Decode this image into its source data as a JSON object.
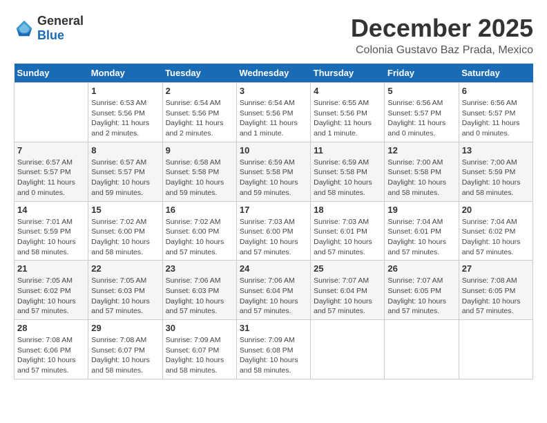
{
  "header": {
    "logo_general": "General",
    "logo_blue": "Blue",
    "title": "December 2025",
    "subtitle": "Colonia Gustavo Baz Prada, Mexico"
  },
  "days_of_week": [
    "Sunday",
    "Monday",
    "Tuesday",
    "Wednesday",
    "Thursday",
    "Friday",
    "Saturday"
  ],
  "weeks": [
    [
      {
        "day": "",
        "info": ""
      },
      {
        "day": "1",
        "info": "Sunrise: 6:53 AM\nSunset: 5:56 PM\nDaylight: 11 hours\nand 2 minutes."
      },
      {
        "day": "2",
        "info": "Sunrise: 6:54 AM\nSunset: 5:56 PM\nDaylight: 11 hours\nand 2 minutes."
      },
      {
        "day": "3",
        "info": "Sunrise: 6:54 AM\nSunset: 5:56 PM\nDaylight: 11 hours\nand 1 minute."
      },
      {
        "day": "4",
        "info": "Sunrise: 6:55 AM\nSunset: 5:56 PM\nDaylight: 11 hours\nand 1 minute."
      },
      {
        "day": "5",
        "info": "Sunrise: 6:56 AM\nSunset: 5:57 PM\nDaylight: 11 hours\nand 0 minutes."
      },
      {
        "day": "6",
        "info": "Sunrise: 6:56 AM\nSunset: 5:57 PM\nDaylight: 11 hours\nand 0 minutes."
      }
    ],
    [
      {
        "day": "7",
        "info": "Sunrise: 6:57 AM\nSunset: 5:57 PM\nDaylight: 11 hours\nand 0 minutes."
      },
      {
        "day": "8",
        "info": "Sunrise: 6:57 AM\nSunset: 5:57 PM\nDaylight: 10 hours\nand 59 minutes."
      },
      {
        "day": "9",
        "info": "Sunrise: 6:58 AM\nSunset: 5:58 PM\nDaylight: 10 hours\nand 59 minutes."
      },
      {
        "day": "10",
        "info": "Sunrise: 6:59 AM\nSunset: 5:58 PM\nDaylight: 10 hours\nand 59 minutes."
      },
      {
        "day": "11",
        "info": "Sunrise: 6:59 AM\nSunset: 5:58 PM\nDaylight: 10 hours\nand 58 minutes."
      },
      {
        "day": "12",
        "info": "Sunrise: 7:00 AM\nSunset: 5:58 PM\nDaylight: 10 hours\nand 58 minutes."
      },
      {
        "day": "13",
        "info": "Sunrise: 7:00 AM\nSunset: 5:59 PM\nDaylight: 10 hours\nand 58 minutes."
      }
    ],
    [
      {
        "day": "14",
        "info": "Sunrise: 7:01 AM\nSunset: 5:59 PM\nDaylight: 10 hours\nand 58 minutes."
      },
      {
        "day": "15",
        "info": "Sunrise: 7:02 AM\nSunset: 6:00 PM\nDaylight: 10 hours\nand 58 minutes."
      },
      {
        "day": "16",
        "info": "Sunrise: 7:02 AM\nSunset: 6:00 PM\nDaylight: 10 hours\nand 57 minutes."
      },
      {
        "day": "17",
        "info": "Sunrise: 7:03 AM\nSunset: 6:00 PM\nDaylight: 10 hours\nand 57 minutes."
      },
      {
        "day": "18",
        "info": "Sunrise: 7:03 AM\nSunset: 6:01 PM\nDaylight: 10 hours\nand 57 minutes."
      },
      {
        "day": "19",
        "info": "Sunrise: 7:04 AM\nSunset: 6:01 PM\nDaylight: 10 hours\nand 57 minutes."
      },
      {
        "day": "20",
        "info": "Sunrise: 7:04 AM\nSunset: 6:02 PM\nDaylight: 10 hours\nand 57 minutes."
      }
    ],
    [
      {
        "day": "21",
        "info": "Sunrise: 7:05 AM\nSunset: 6:02 PM\nDaylight: 10 hours\nand 57 minutes."
      },
      {
        "day": "22",
        "info": "Sunrise: 7:05 AM\nSunset: 6:03 PM\nDaylight: 10 hours\nand 57 minutes."
      },
      {
        "day": "23",
        "info": "Sunrise: 7:06 AM\nSunset: 6:03 PM\nDaylight: 10 hours\nand 57 minutes."
      },
      {
        "day": "24",
        "info": "Sunrise: 7:06 AM\nSunset: 6:04 PM\nDaylight: 10 hours\nand 57 minutes."
      },
      {
        "day": "25",
        "info": "Sunrise: 7:07 AM\nSunset: 6:04 PM\nDaylight: 10 hours\nand 57 minutes."
      },
      {
        "day": "26",
        "info": "Sunrise: 7:07 AM\nSunset: 6:05 PM\nDaylight: 10 hours\nand 57 minutes."
      },
      {
        "day": "27",
        "info": "Sunrise: 7:08 AM\nSunset: 6:05 PM\nDaylight: 10 hours\nand 57 minutes."
      }
    ],
    [
      {
        "day": "28",
        "info": "Sunrise: 7:08 AM\nSunset: 6:06 PM\nDaylight: 10 hours\nand 57 minutes."
      },
      {
        "day": "29",
        "info": "Sunrise: 7:08 AM\nSunset: 6:07 PM\nDaylight: 10 hours\nand 58 minutes."
      },
      {
        "day": "30",
        "info": "Sunrise: 7:09 AM\nSunset: 6:07 PM\nDaylight: 10 hours\nand 58 minutes."
      },
      {
        "day": "31",
        "info": "Sunrise: 7:09 AM\nSunset: 6:08 PM\nDaylight: 10 hours\nand 58 minutes."
      },
      {
        "day": "",
        "info": ""
      },
      {
        "day": "",
        "info": ""
      },
      {
        "day": "",
        "info": ""
      }
    ]
  ]
}
